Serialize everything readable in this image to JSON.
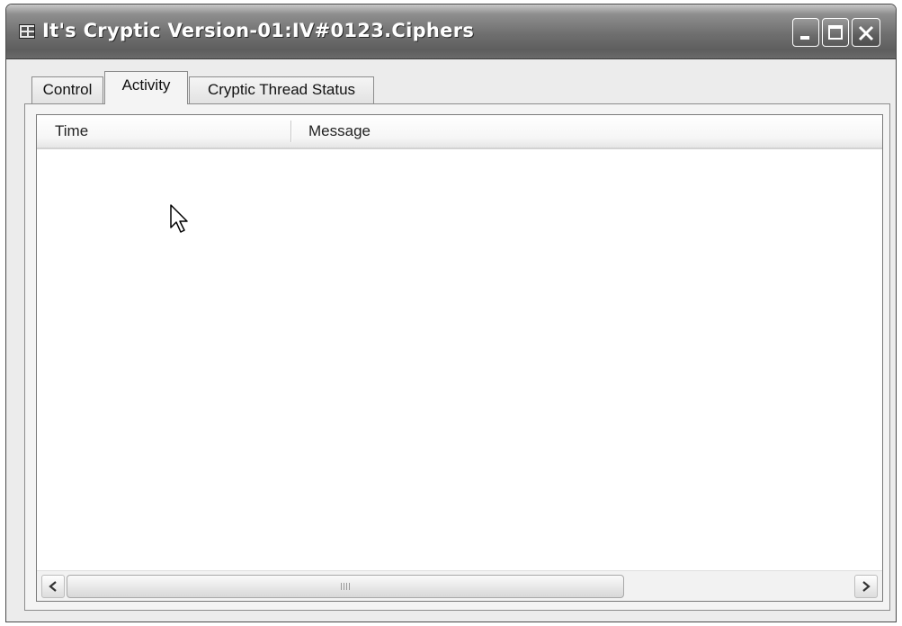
{
  "window": {
    "title": "It's Cryptic Version-01:IV#0123.Ciphers",
    "icon": "app-window-icon",
    "buttons": [
      "minimize",
      "maximize",
      "close"
    ]
  },
  "tabs": [
    {
      "label": "Control",
      "active": false
    },
    {
      "label": "Activity",
      "active": true
    },
    {
      "label": "Cryptic Thread Status",
      "active": false
    }
  ],
  "listview": {
    "columns": [
      {
        "label": "Time"
      },
      {
        "label": "Message"
      }
    ],
    "rows": []
  },
  "colors": {
    "titlebar": "#6f6f6f",
    "window_bg": "#ececec",
    "list_bg": "#ffffff"
  }
}
